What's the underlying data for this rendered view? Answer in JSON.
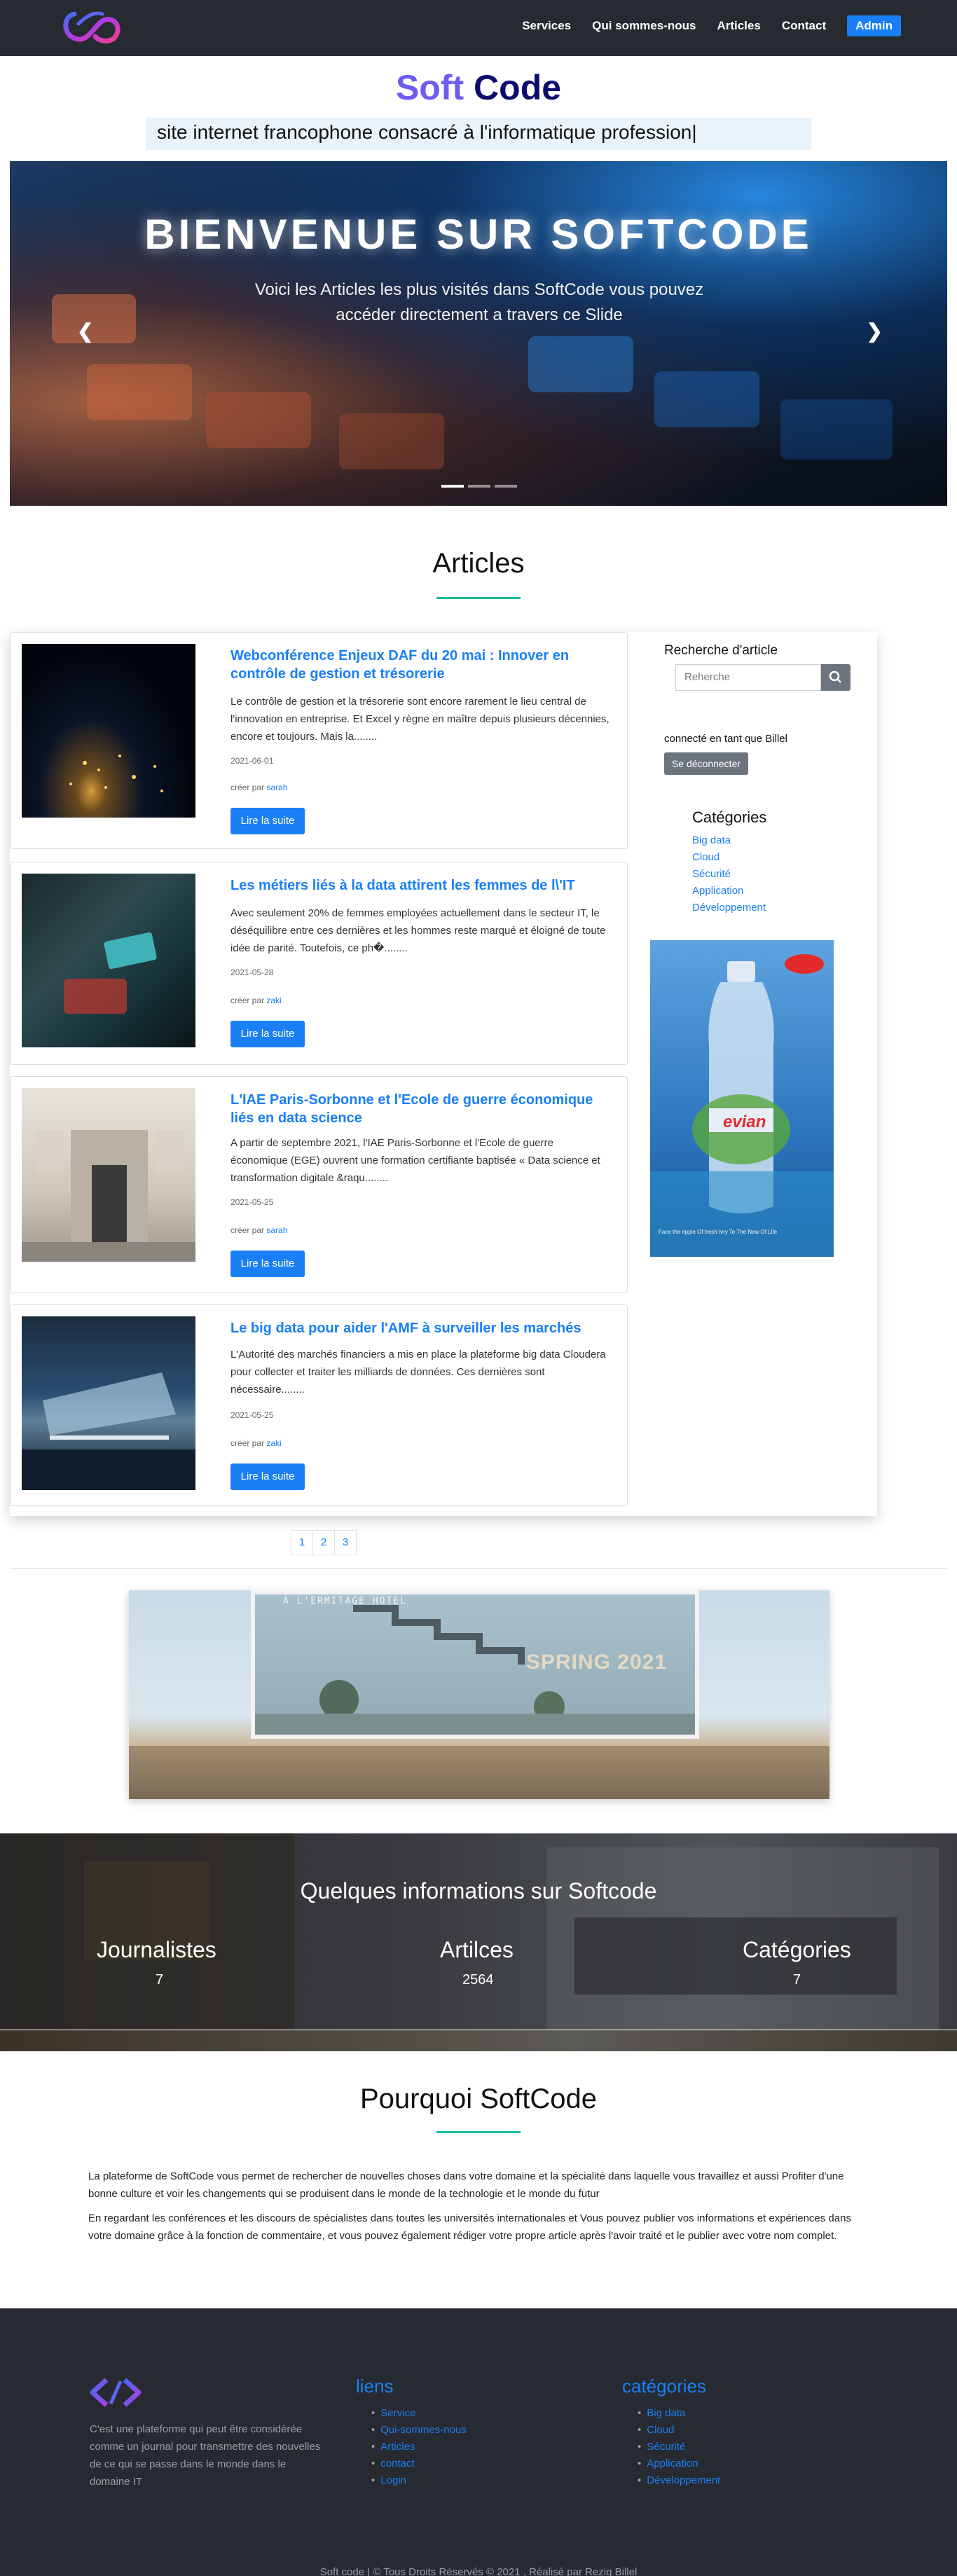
{
  "nav": {
    "logo": "softcode-logo",
    "links": [
      "Services",
      "Qui sommes-nous",
      "Articles",
      "Contact"
    ],
    "admin": "Admin"
  },
  "hero": {
    "title_soft": "Soft",
    "title_code": "Code",
    "tagline": "site internet francophone consacré à l'informatique profession|"
  },
  "carousel": {
    "title": "BIENVENUE SUR SOFTCODE",
    "subtitle": "Voici les Articles les plus visités dans SoftCode vous pouvez accéder directement a travers ce Slide",
    "prev_icon": "chevron-left-icon",
    "next_icon": "chevron-right-icon",
    "slide_count": 3,
    "active_slide": 1
  },
  "articles": {
    "heading": "Articles",
    "items": [
      {
        "title": "Webconférence Enjeux DAF du 20 mai : Innover en contrôle de gestion et trésorerie",
        "excerpt": "Le contrôle de gestion et la trésorerie sont encore rarement le lieu central de l'innovation en entreprise. Et Excel y règne en maître depuis plusieurs décennies, encore et toujours. Mais la........",
        "date": "2021-06-01",
        "by": "créer par",
        "author": "sarah",
        "button": "Lire la suite"
      },
      {
        "title": "Les métiers liés à la data attirent les femmes de l\\'IT",
        "excerpt": "Avec seulement 20% de femmes employées actuellement dans le secteur IT, le déséquilibre entre ces dernières et les hommes reste marqué et éloigné de toute idée de parité. Toutefois, ce ph�........",
        "date": "2021-05-28",
        "by": "créer par",
        "author": "zaki",
        "button": "Lire la suite"
      },
      {
        "title": "L'IAE Paris-Sorbonne et l'Ecole de guerre économique liés en data science",
        "excerpt": "A partir de septembre 2021, l'IAE Paris-Sorbonne et l'Ecole de guerre économique (EGE) ouvrent une formation certifiante baptisée « Data science et transformation digitale &raqu........",
        "date": "2021-05-25",
        "by": "créer par",
        "author": "sarah",
        "button": "Lire la suite"
      },
      {
        "title": "Le big data pour aider l'AMF à surveiller les marchés",
        "excerpt": "L'Autorité des marchés financiers a mis en place la plateforme big data Cloudera pour collecter et traiter les milliards de données. Ces dernières sont nécessaire........",
        "date": "2021-05-25",
        "by": "créer par",
        "author": "zaki",
        "button": "Lire la suite"
      }
    ],
    "pages": [
      "1",
      "2",
      "3"
    ]
  },
  "sidebar": {
    "search_heading": "Recherche d'article",
    "search_placeholder": "Reherche",
    "search_icon": "search-icon",
    "connected": "connecté en tant que Billel",
    "logout": "Se déconnecter",
    "categories_heading": "Catégories",
    "categories": [
      "Big data",
      "Cloud",
      "Sécurité",
      "Application",
      "Développement"
    ],
    "ad_brand": "evian",
    "ad_caption": "Face the ripple Of fresh Ivry To The New Of Life"
  },
  "billboard": {
    "top_text": "A L'ERMITAGE HOTEL",
    "board_text": "SPRING 2021"
  },
  "stats": {
    "heading": "Quelques informations sur Softcode",
    "items": [
      {
        "label": "Journalistes",
        "value": "7"
      },
      {
        "label": "Artilces",
        "value": "2564"
      },
      {
        "label": "Catégories",
        "value": "7"
      }
    ]
  },
  "why": {
    "heading": "Pourquoi SoftCode",
    "p1": "La plateforme de SoftCode vous permet de rechercher de nouvelles choses dans votre domaine et la spécialité dans laquelle vous travaillez et aussi Profiter d'une bonne culture et voir les changements qui se produisent dans le monde de la technologie et le monde du futur",
    "p2": "En regardant les conférences et les discours de spécialistes dans toutes les universités internationales et Vous pouvez publier vos informations et expériences dans votre domaine grâce à la fonction de commentaire, et vous pouvez également rédiger votre propre article après l'avoir traité et le publier avec votre nom complet."
  },
  "footer": {
    "about": "C'est une plateforme qui peut être considérée comme un journal pour transmettre des nouvelles de ce qui se passe dans le monde dans le domaine IT",
    "links_heading": "liens",
    "links": [
      "Service",
      "Qui-sommes-nous",
      "Articles",
      "contact",
      "Login"
    ],
    "cats_heading": "catégories",
    "cats": [
      "Big data",
      "Cloud",
      "Sécurité",
      "Application",
      "Développement"
    ],
    "copyright": "Soft code | © Tous Droits Réservés © 2021 , Réalisé par Rezig Billel"
  }
}
